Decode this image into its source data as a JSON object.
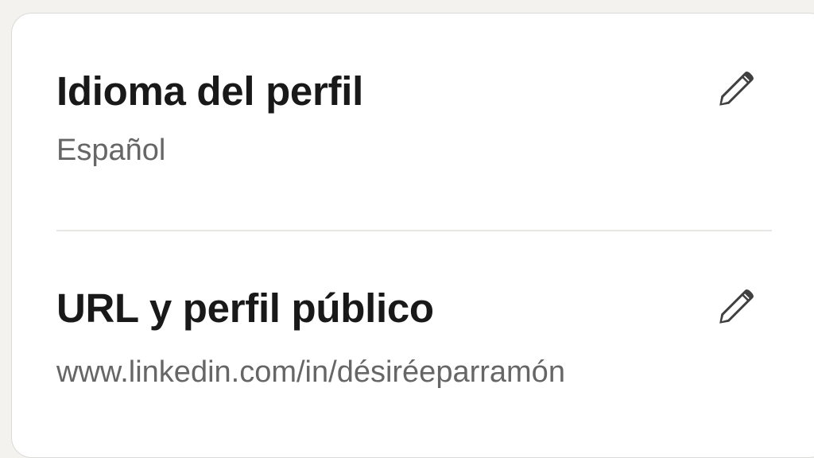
{
  "profile_language": {
    "title": "Idioma del perfil",
    "value": "Español",
    "edit_icon": "pencil-icon"
  },
  "public_profile": {
    "title": "URL y perfil público",
    "value": "www.linkedin.com/in/désiréeparramón",
    "edit_icon": "pencil-icon"
  },
  "colors": {
    "card_background": "#ffffff",
    "page_background": "#f3f2ef",
    "heading_text": "#191919",
    "secondary_text": "#666666",
    "icon": "#404040"
  }
}
